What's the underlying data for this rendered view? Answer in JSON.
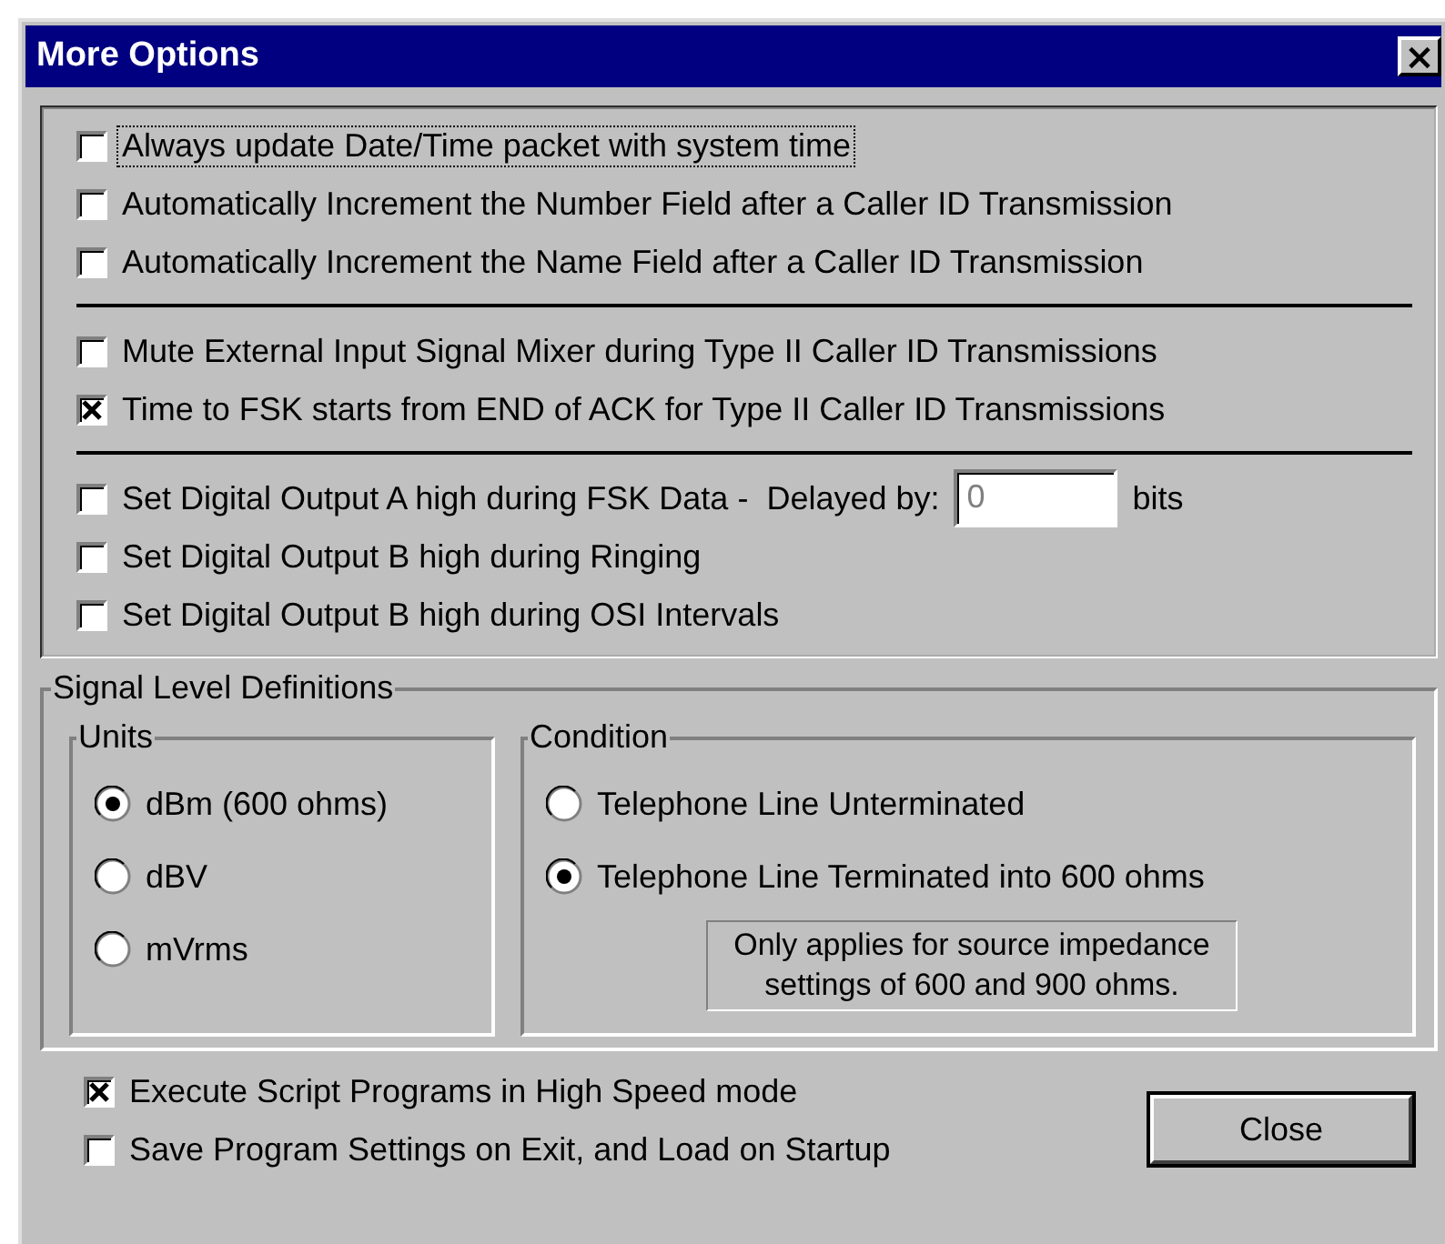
{
  "window": {
    "title": "More Options",
    "close_glyph": "×"
  },
  "option_groups": [
    {
      "options": [
        {
          "kind": "checkbox",
          "label": "Always update Date/Time packet with system time",
          "checked": false,
          "focused": true
        },
        {
          "kind": "checkbox",
          "label": "Automatically Increment the Number Field after a Caller ID Transmission",
          "checked": false,
          "focused": false
        },
        {
          "kind": "checkbox",
          "label": "Automatically Increment the Name Field after a Caller ID Transmission",
          "checked": false,
          "focused": false
        }
      ]
    },
    {
      "options": [
        {
          "kind": "checkbox",
          "label": "Mute External Input Signal Mixer during Type II Caller ID Transmissions",
          "checked": false,
          "focused": false
        },
        {
          "kind": "checkbox",
          "label": "Time to FSK starts from END of ACK for Type II Caller ID Transmissions",
          "checked": true,
          "focused": false
        }
      ]
    },
    {
      "options": [
        {
          "kind": "delay",
          "label": "Set Digital Output A high during FSK Data -",
          "checked": false,
          "focused": false,
          "field_label": "Delayed by:",
          "field_value": "0",
          "field_disabled": true,
          "unit": "bits"
        },
        {
          "kind": "checkbox",
          "label": "Set Digital Output B high during Ringing",
          "checked": false,
          "focused": false
        },
        {
          "kind": "checkbox",
          "label": "Set Digital Output B high during OSI Intervals",
          "checked": false,
          "focused": false
        }
      ]
    }
  ],
  "signal_levels": {
    "title": "Signal Level Definitions",
    "units": {
      "title": "Units",
      "options": [
        {
          "label": "dBm (600 ohms)",
          "selected": true
        },
        {
          "label": "dBV",
          "selected": false
        },
        {
          "label": "mVrms",
          "selected": false
        }
      ]
    },
    "condition": {
      "title": "Condition",
      "options": [
        {
          "label": "Telephone Line Unterminated",
          "selected": false
        },
        {
          "label": "Telephone Line Terminated into 600 ohms",
          "selected": true
        }
      ],
      "note": [
        "Only applies for source impedance",
        "settings of 600 and 900 ohms."
      ]
    }
  },
  "bottom_options": [
    {
      "kind": "checkbox",
      "label": "Execute Script Programs in High Speed mode",
      "checked": true,
      "focused": false
    },
    {
      "kind": "checkbox",
      "label": "Save Program Settings on Exit, and Load on Startup",
      "checked": false,
      "focused": false
    }
  ],
  "buttons": [
    {
      "label": "Close",
      "default": true
    }
  ]
}
